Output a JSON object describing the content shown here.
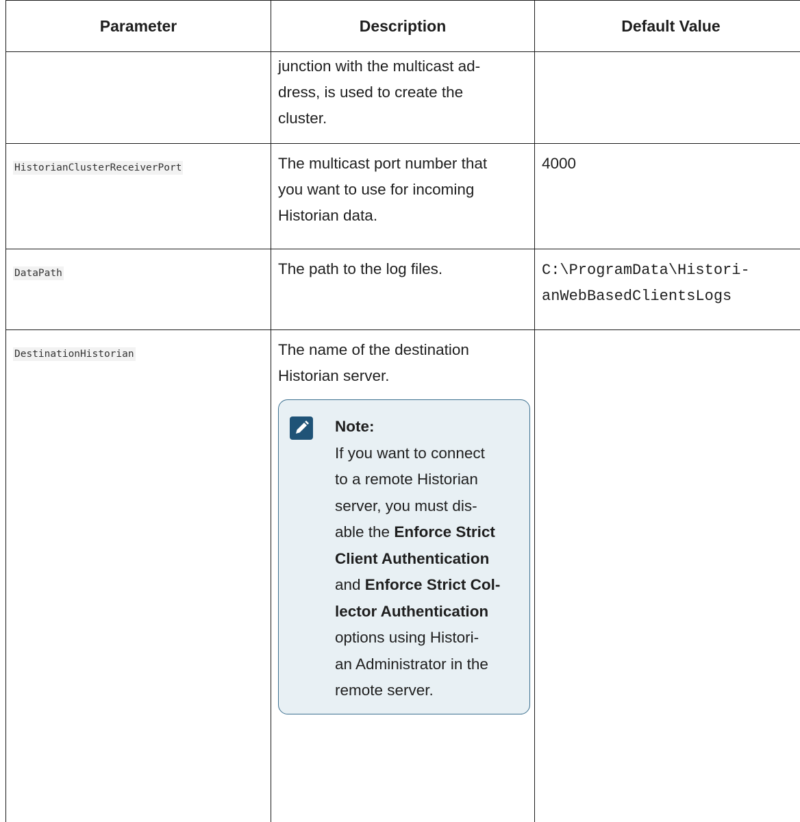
{
  "table": {
    "headers": [
      "Parameter",
      "Description",
      "Default Value"
    ],
    "rows": [
      {
        "parameter": "",
        "description_lines": [
          "junction with the multicast ad-",
          "dress, is used to create the",
          "cluster."
        ],
        "default": ""
      },
      {
        "parameter": "HistorianClusterReceiverPort",
        "description_lines": [
          "The multicast port number that",
          "you want to use for incoming",
          "Historian data."
        ],
        "default": "4000"
      },
      {
        "parameter": "DataPath",
        "description_lines": [
          "The path to the log files."
        ],
        "default_lines": [
          "C:\\ProgramData\\Histori-",
          "anWebBasedClientsLogs"
        ]
      },
      {
        "parameter": "DestinationHistorian",
        "description_lines": [
          "The name of the destination",
          "Historian server."
        ],
        "default": "",
        "note": {
          "icon": "pencil-note-icon",
          "title": "Note:",
          "lines": [
            [
              "If you want to connect"
            ],
            [
              "to a remote Historian"
            ],
            [
              "server, you must dis-"
            ],
            [
              "able the ",
              {
                "bold": "Enforce Strict"
              }
            ],
            [
              {
                "bold": "Client Authentication"
              }
            ],
            [
              "and ",
              {
                "bold": "Enforce Strict Col-"
              }
            ],
            [
              {
                "bold": "lector Authentication"
              }
            ],
            [
              "options using Histori-"
            ],
            [
              "an Administrator in the"
            ],
            [
              "remote server."
            ]
          ],
          "l0": "If you want to connect",
          "l1": "to a remote Historian",
          "l2": "server, you must dis-",
          "l3a": "able the ",
          "l3b": "Enforce Strict",
          "l4": "Client Authentication",
          "l5a": "and ",
          "l5b": "Enforce Strict Col-",
          "l6": "lector Authentication",
          "l7": "options using Histori-",
          "l8": "an Administrator in the",
          "l9": "remote server."
        }
      }
    ]
  },
  "colors": {
    "note_bg": "#e8f0f4",
    "note_border": "#3b6f8f",
    "note_icon": "#1f5377",
    "code_bg": "#f2f2f2"
  }
}
